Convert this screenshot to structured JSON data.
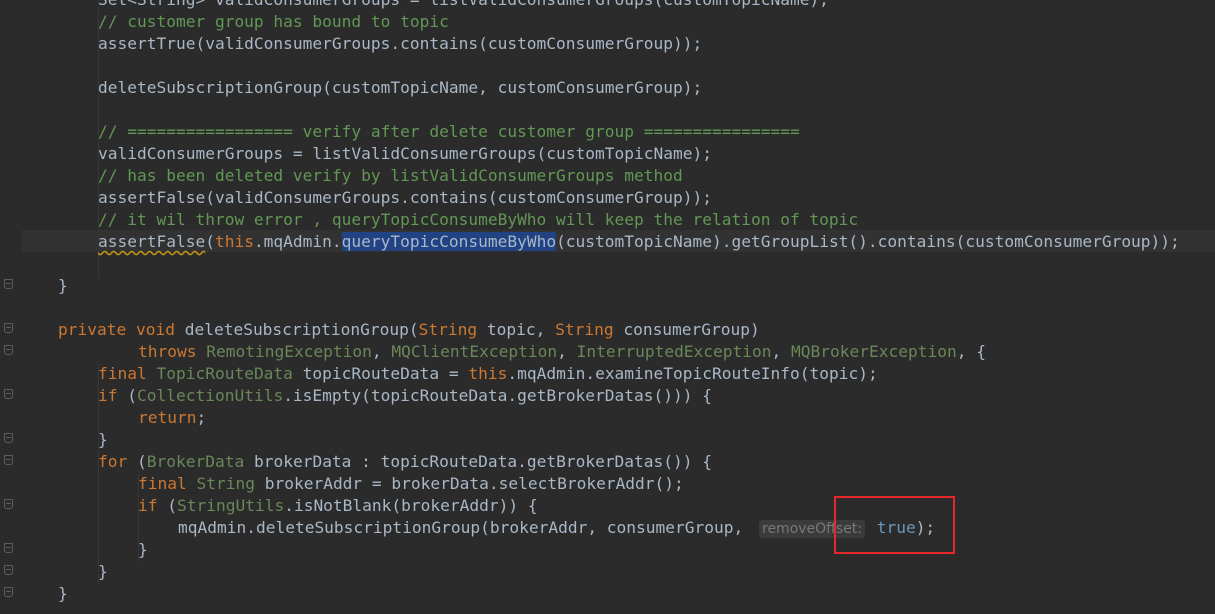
{
  "editor": {
    "lines": [
      [
        "Set<String> validConsumerGroups = listValidConsumerGroups(customTopicName);"
      ],
      [
        "// customer group has bound to topic"
      ],
      [
        "assertTrue(validConsumerGroups.contains(customConsumerGroup));"
      ],
      [
        ""
      ],
      [
        "deleteSubscriptionGroup(customTopicName, customConsumerGroup);"
      ],
      [
        ""
      ],
      [
        "// ================= verify after delete customer group ================"
      ],
      [
        "validConsumerGroups = listValidConsumerGroups(customTopicName);"
      ],
      [
        "// has been deleted verify by listValidConsumerGroups method"
      ],
      [
        "assertFalse(validConsumerGroups.contains(customConsumerGroup));"
      ],
      [
        "// it wil throw error , queryTopicConsumeByWho will keep the relation of topic"
      ],
      [
        "assertFalse",
        "(",
        "this",
        ".mqAdmin.",
        "queryTopicConsumeByWho",
        "(customTopicName).getGroupList().contains(customConsumerGroup));"
      ],
      [
        ""
      ],
      [
        "}"
      ],
      [
        ""
      ],
      [
        "private",
        "void",
        "deleteSubscriptionGroup(",
        "String",
        "topic,",
        "String",
        "consumerGroup)"
      ],
      [
        "throws",
        "RemotingException",
        "MQClientException",
        "InterruptedException",
        "MQBrokerException",
        "{"
      ],
      [
        "final",
        "TopicRouteData",
        "topicRouteData = ",
        "this",
        ".mqAdmin.examineTopicRouteInfo(topic);"
      ],
      [
        "if",
        "(",
        "CollectionUtils",
        ".isEmpty(topicRouteData.getBrokerDatas())) {"
      ],
      [
        "return",
        ";"
      ],
      [
        "}"
      ],
      [
        "for",
        "(",
        "BrokerData",
        "brokerData : topicRouteData.getBrokerDatas()) {"
      ],
      [
        "final",
        "String",
        "brokerAddr = brokerData.selectBrokerAddr();"
      ],
      [
        "if",
        "(",
        "StringUtils",
        ".isNotBlank(brokerAddr)) {"
      ],
      [
        "mqAdmin.deleteSubscriptionGroup(brokerAddr, consumerGroup, ",
        "removeOffset:",
        "true",
        ");"
      ],
      [
        "}"
      ],
      [
        "}"
      ],
      [
        "}"
      ]
    ],
    "hint_label": "removeOffset:",
    "hint_value": "true"
  }
}
